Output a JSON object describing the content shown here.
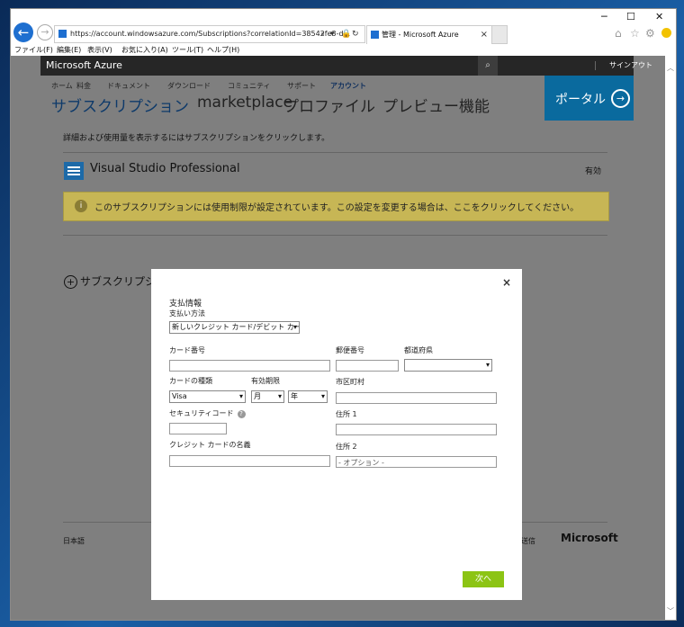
{
  "browser": {
    "url": "https://account.windowsazure.com/Subscriptions?correlationId=38542fe3-d...",
    "tab_title": "管理 - Microsoft Azure",
    "window_controls": {
      "minimize": "─",
      "maximize": "☐",
      "close": "✕"
    },
    "menu": [
      "ファイル(F)",
      "編集(E)",
      "表示(V)",
      "お気に入り(A)",
      "ツール(T)",
      "ヘルプ(H)"
    ]
  },
  "azure": {
    "brand": "Microsoft Azure",
    "signout": "サインアウト",
    "nav_small": [
      "ホーム",
      "料金",
      "ドキュメント",
      "ダウンロード",
      "コミュニティ",
      "サポート",
      "アカウント"
    ],
    "nav_big": [
      "サブスクリプション",
      "marketplace",
      "プロファイル",
      "プレビュー機能"
    ],
    "portal_label": "ポータル",
    "hint": "詳細および使用量を表示するにはサブスクリプションをクリックします。",
    "subscription_name": "Visual Studio Professional",
    "subscription_status": "有効",
    "warning_text": "このサブスクリプションには使用制限が設定されています。この設定を変更する場合は、ここをクリックしてください。",
    "add_subscription": "サブスクリプシ",
    "footer_lang": "日本語",
    "footer_feedback": "フの送信",
    "footer_brand": "Microsoft"
  },
  "modal": {
    "section_title": "支払情報",
    "method_label": "支払い方法",
    "method_value": "新しいクレジット カード/デビット カード",
    "card_number_label": "カード番号",
    "card_type_label": "カードの種類",
    "card_type_value": "Visa",
    "expiry_label": "有効期限",
    "month_value": "月",
    "year_value": "年",
    "cvv_label": "セキュリティコード",
    "name_label": "クレジット カードの名義",
    "zip_label": "郵便番号",
    "pref_label": "都道府県",
    "city_label": "市区町村",
    "addr1_label": "住所 1",
    "addr2_label": "住所 2",
    "addr2_placeholder": "- オプション -",
    "next_button": "次へ",
    "close": "×"
  }
}
